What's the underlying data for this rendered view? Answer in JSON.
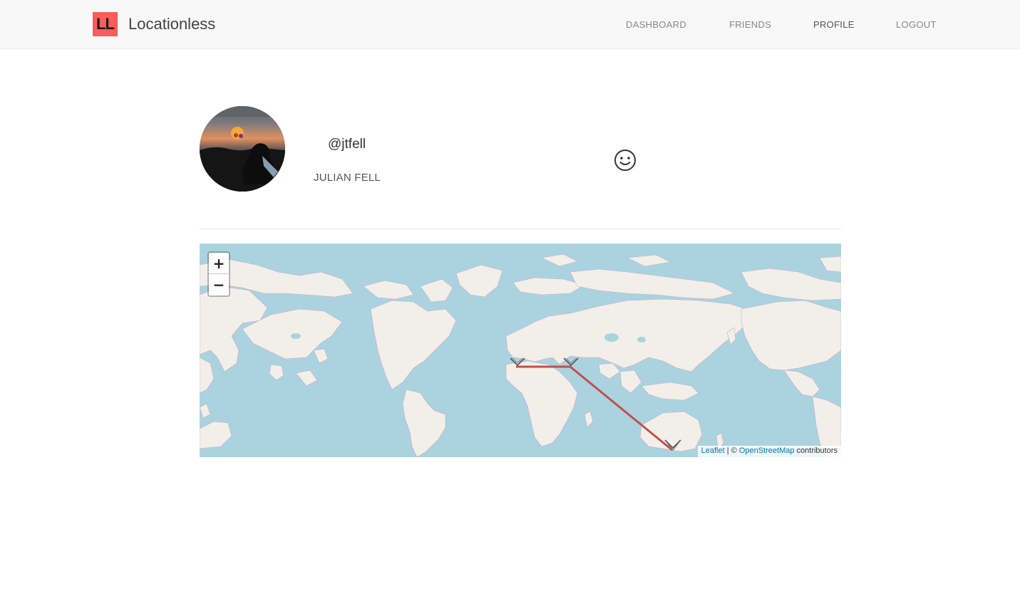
{
  "app": {
    "logo_text": "LL",
    "name": "Locationless",
    "brand_color": "#fb5b5a"
  },
  "nav": {
    "dashboard": "DASHBOARD",
    "friends": "FRIENDS",
    "profile": "PROFILE",
    "logout": "LOGOUT"
  },
  "profile": {
    "handle": "@jtfell",
    "full_name": "JULIAN FELL",
    "status_icon": "smiley-icon"
  },
  "map": {
    "zoom_in": "+",
    "zoom_out": "−",
    "attribution": {
      "leaflet": "Leaflet",
      "separator": " | © ",
      "osm": "OpenStreetMap",
      "suffix": " contributors"
    },
    "route_color": "#c0504d",
    "markers": 3
  }
}
